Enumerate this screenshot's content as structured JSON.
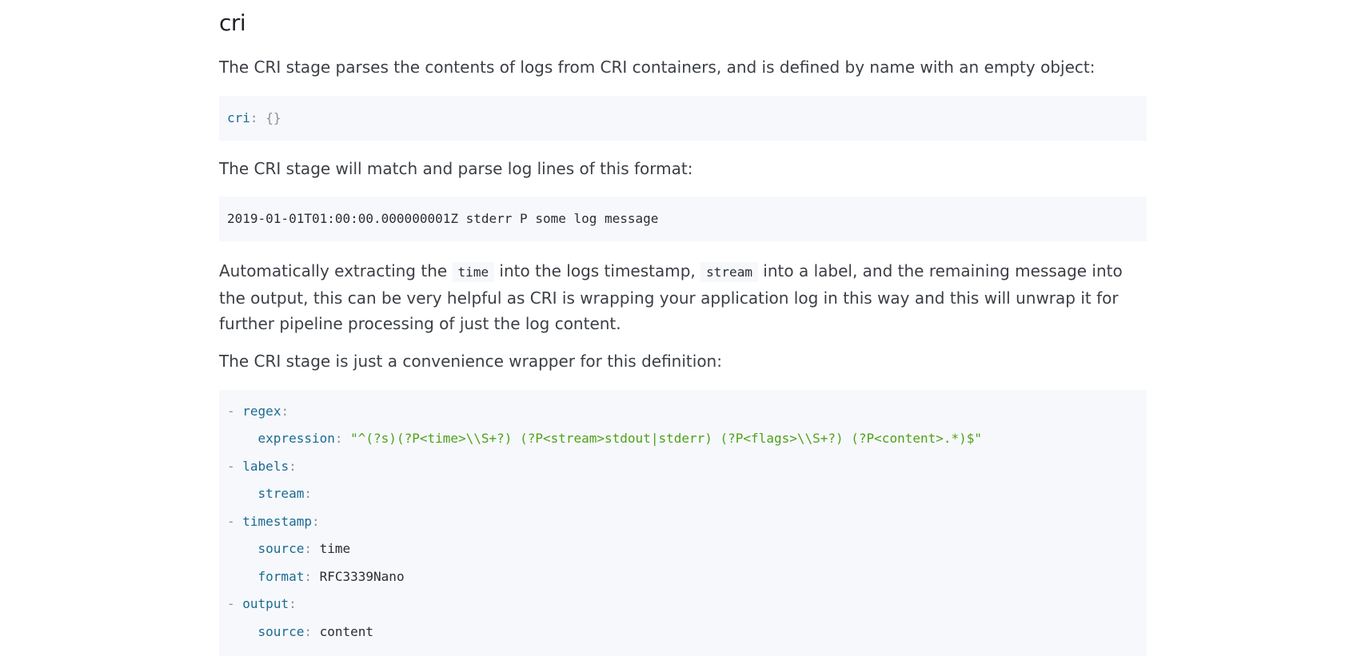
{
  "heading": "cri",
  "intro": "The CRI stage parses the contents of logs from CRI containers, and is defined by name with an empty object:",
  "code1": {
    "key": "cri",
    "colon": ":",
    "value": "{}"
  },
  "match_text": "The CRI stage will match and parse log lines of this format:",
  "code2": {
    "line": "2019-01-01T01:00:00.000000001Z stderr P some log message"
  },
  "auto": {
    "part1": "Automatically extracting the ",
    "code_time": "time",
    "part2": " into the logs timestamp, ",
    "code_stream": "stream",
    "part3": " into a label, and the remaining message into the output, this can be very helpful as CRI is wrapping your application log in this way and this will unwrap it for further pipeline processing of just the log content."
  },
  "wrapper_text": "The CRI stage is just a convenience wrapper for this definition:",
  "code3": {
    "dash": "-",
    "colon": ":",
    "regex_key": "regex",
    "expression_key": "expression",
    "expression_value": "\"^(?s)(?P<time>\\\\S+?) (?P<stream>stdout|stderr) (?P<flags>\\\\S+?) (?P<content>.*)$\"",
    "labels_key": "labels",
    "stream_key": "stream",
    "timestamp_key": "timestamp",
    "source_key": "source",
    "source_time_value": "time",
    "format_key": "format",
    "format_value": "RFC3339Nano",
    "output_key": "output",
    "source_content_value": "content"
  }
}
